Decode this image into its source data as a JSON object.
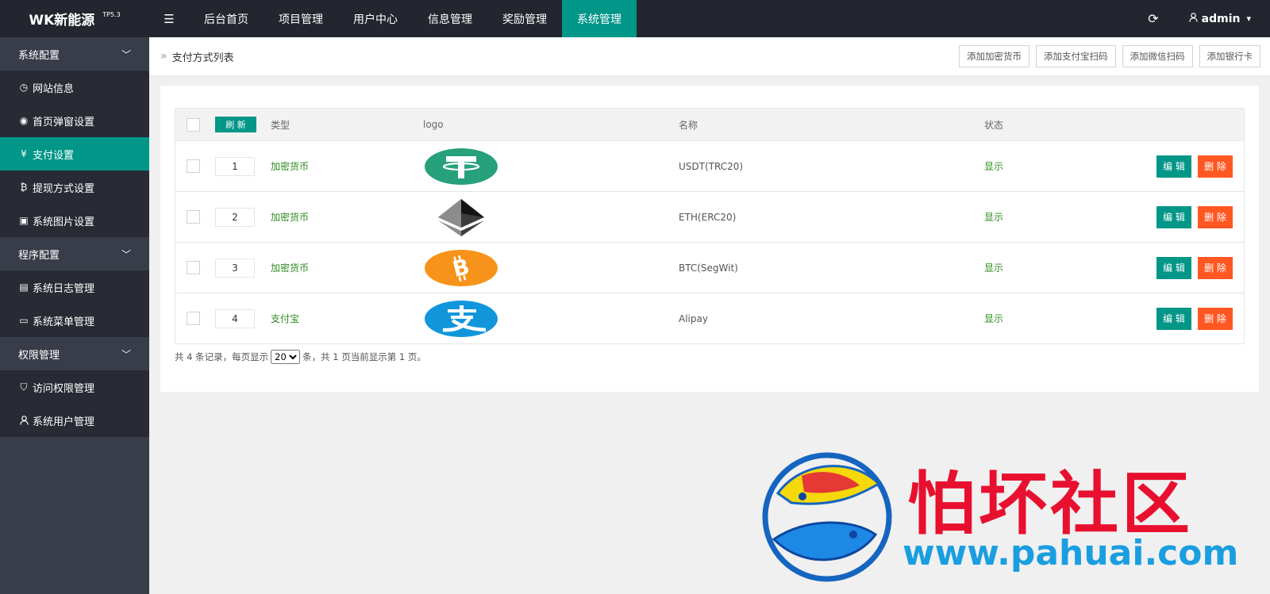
{
  "brand": {
    "name": "WK新能源",
    "version": "TP5.3"
  },
  "topnav": [
    {
      "label": "后台首页",
      "active": false
    },
    {
      "label": "项目管理",
      "active": false
    },
    {
      "label": "用户中心",
      "active": false
    },
    {
      "label": "信息管理",
      "active": false
    },
    {
      "label": "奖励管理",
      "active": false
    },
    {
      "label": "系统管理",
      "active": true
    }
  ],
  "user": {
    "name": "admin"
  },
  "sidebar": {
    "groups": [
      {
        "label": "系统配置",
        "items": [
          {
            "label": "网站信息",
            "icon": "dashboard-icon"
          },
          {
            "label": "首页弹窗设置",
            "icon": "eye-icon"
          },
          {
            "label": "支付设置",
            "icon": "yen-icon",
            "active": true
          },
          {
            "label": "提现方式设置",
            "icon": "bitcoin-icon"
          },
          {
            "label": "系统图片设置",
            "icon": "image-icon"
          }
        ]
      },
      {
        "label": "程序配置",
        "items": [
          {
            "label": "系统日志管理",
            "icon": "clipboard-icon"
          },
          {
            "label": "系统菜单管理",
            "icon": "window-icon"
          }
        ]
      },
      {
        "label": "权限管理",
        "items": [
          {
            "label": "访问权限管理",
            "icon": "shield-icon"
          },
          {
            "label": "系统用户管理",
            "icon": "user-icon"
          }
        ]
      }
    ]
  },
  "page": {
    "title": "支付方式列表",
    "actions": [
      "添加加密货币",
      "添加支付宝扫码",
      "添加微信扫码",
      "添加银行卡"
    ]
  },
  "table": {
    "refresh_label": "刷 新",
    "headers": {
      "type": "类型",
      "logo": "logo",
      "name": "名称",
      "status": "状态"
    },
    "edit_label": "编 辑",
    "delete_label": "删 除",
    "rows": [
      {
        "sort": "1",
        "type": "加密货币",
        "logo": "tether-logo-icon",
        "name": "USDT(TRC20)",
        "status": "显示"
      },
      {
        "sort": "2",
        "type": "加密货币",
        "logo": "ethereum-logo-icon",
        "name": "ETH(ERC20)",
        "status": "显示"
      },
      {
        "sort": "3",
        "type": "加密货币",
        "logo": "bitcoin-logo-icon",
        "name": "BTC(SegWit)",
        "status": "显示"
      },
      {
        "sort": "4",
        "type": "支付宝",
        "logo": "alipay-logo-icon",
        "name": "Alipay",
        "status": "显示"
      }
    ]
  },
  "pager": {
    "prefix": "共 4 条记录，每页显示",
    "page_size": "20",
    "suffix": "条，共 1 页当前显示第 1 页。"
  },
  "watermark": {
    "title": "怕坏社区",
    "url": "www.pahuai.com"
  },
  "colors": {
    "accent": "#009688",
    "danger": "#ff5722",
    "header": "#23262e",
    "sidebar": "#393d49"
  }
}
